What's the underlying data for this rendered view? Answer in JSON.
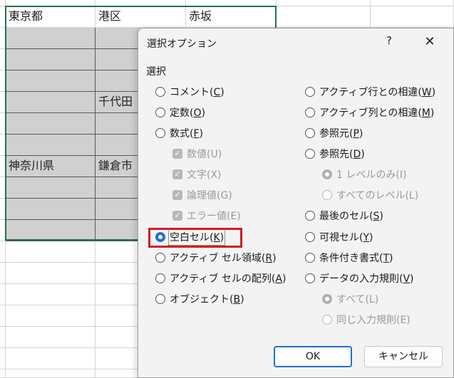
{
  "sheet": {
    "row1": [
      "東京都",
      "港区",
      "赤坂"
    ],
    "row5_col2": "千代田",
    "row8": [
      "神奈川県",
      "鎌倉市"
    ]
  },
  "dialog": {
    "title": "選択オプション",
    "help": "?",
    "close": "✕",
    "group": "選択",
    "left": {
      "comment": {
        "pre": "コメント(",
        "key": "C",
        "post": ")"
      },
      "constants": {
        "pre": "定数(",
        "key": "O",
        "post": ")"
      },
      "formulas": {
        "pre": "数式(",
        "key": "F",
        "post": ")"
      },
      "numbers": "数値(U)",
      "text": "文字(X)",
      "logicals": "論理値(G)",
      "errors": "エラー値(E)",
      "blanks": {
        "pre": "空白セル(",
        "key": "K",
        "post": ")"
      },
      "current_region": {
        "pre": "アクティブ セル領域(",
        "key": "R",
        "post": ")"
      },
      "current_array": {
        "pre": "アクティブ セルの配列(",
        "key": "A",
        "post": ")"
      },
      "objects": {
        "pre": "オブジェクト(",
        "key": "B",
        "post": ")"
      }
    },
    "right": {
      "row_diff": {
        "pre": "アクティブ行との相違(",
        "key": "W",
        "post": ")"
      },
      "col_diff": {
        "pre": "アクティブ列との相違(",
        "key": "M",
        "post": ")"
      },
      "precedents": {
        "pre": "参照元(",
        "key": "P",
        "post": ")"
      },
      "dependents": {
        "pre": "参照先(",
        "key": "D",
        "post": ")"
      },
      "direct_only": "1 レベルのみ(I)",
      "all_levels": "すべてのレベル(L)",
      "last_cell": {
        "pre": "最後のセル(",
        "key": "S",
        "post": ")"
      },
      "visible_cells": {
        "pre": "可視セル(",
        "key": "Y",
        "post": ")"
      },
      "cond_formats": {
        "pre": "条件付き書式(",
        "key": "T",
        "post": ")"
      },
      "data_validation": {
        "pre": "データの入力規則(",
        "key": "V",
        "post": ")"
      },
      "dv_all": "すべて(L)",
      "dv_same": "同じ入力規則(E)"
    },
    "ok": "OK",
    "cancel": "キャンセル"
  },
  "colors": {
    "accent": "#1f6fd1",
    "highlight": "#d01e22",
    "selection_border": "#217346"
  }
}
